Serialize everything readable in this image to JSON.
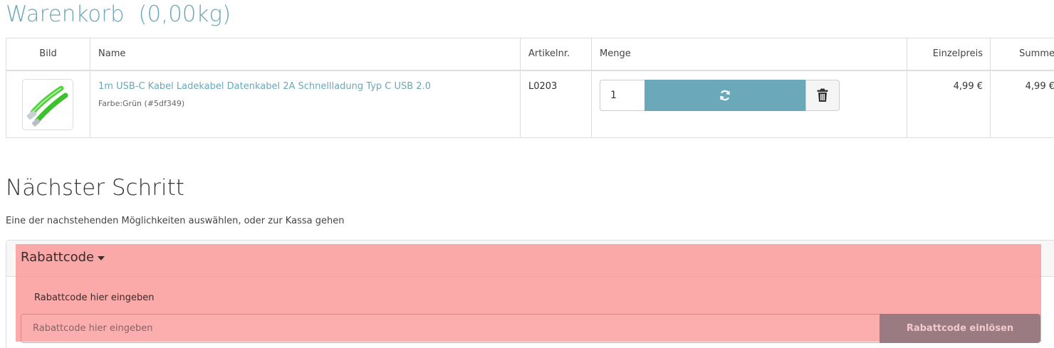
{
  "cart": {
    "title": "Warenkorb  (0,00kg)",
    "columns": [
      "Bild",
      "Name",
      "Artikelnr.",
      "Menge",
      "Einzelpreis",
      "Summe"
    ],
    "items": [
      {
        "name": "1m USB-C Kabel Ladekabel Datenkabel 2A Schnellladung Typ C USB 2.0",
        "variant": "Farbe:Grün (#5df349)",
        "article_no": "L0203",
        "quantity": "1",
        "unit_price": "4,99 €",
        "sum": "4,99 €"
      }
    ],
    "icons": {
      "refresh": "refresh-icon",
      "delete": "trash-icon"
    },
    "accent_color": "#6aa8ba"
  },
  "next_step": {
    "title": "Nächster Schritt",
    "description": "Eine der nachstehenden Möglichkeiten auswählen, oder zur Kassa gehen"
  },
  "coupon": {
    "toggle_label": "Rabattcode",
    "field_label": "Rabattcode hier eingeben",
    "input_placeholder": "Rabattcode hier eingeben",
    "input_value": "",
    "submit_label": "Rabattcode einlösen"
  }
}
